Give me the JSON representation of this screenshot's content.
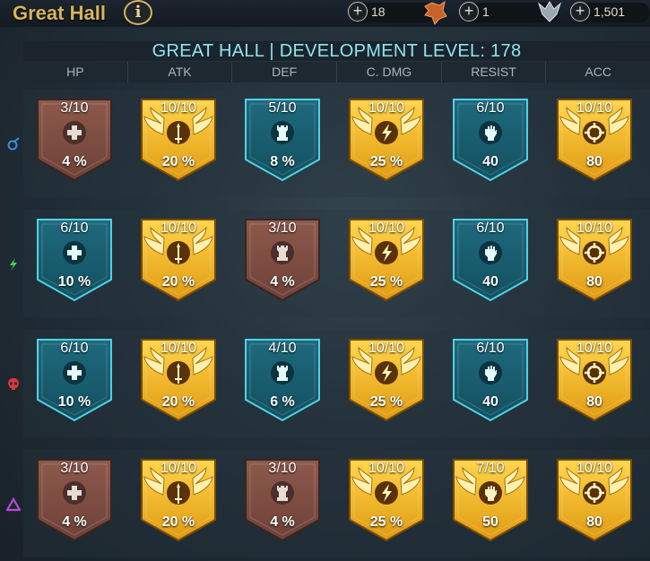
{
  "window": {
    "title": "Great Hall"
  },
  "resources": [
    {
      "name": "red-gem",
      "amount": "18"
    },
    {
      "name": "silver-medal",
      "amount": "1"
    },
    {
      "name": "gold-medal",
      "amount": "1,501"
    }
  ],
  "hall": {
    "title": "GREAT HALL | DEVELOPMENT LEVEL: 178",
    "columns": [
      "HP",
      "ATK",
      "DEF",
      "C. DMG",
      "RESIST",
      "ACC"
    ]
  },
  "affinities": [
    {
      "name": "magic",
      "color": "#3a8fd8"
    },
    {
      "name": "spirit",
      "color": "#3fd84a"
    },
    {
      "name": "force",
      "color": "#e0363a"
    },
    {
      "name": "void",
      "color": "#b94bd8"
    }
  ],
  "rows": [
    {
      "affinity": "magic",
      "cells": [
        {
          "stat": "hp",
          "level": "3/10",
          "value": "4 %",
          "tier": "bronze"
        },
        {
          "stat": "atk",
          "level": "10/10",
          "value": "20 %",
          "tier": "gold"
        },
        {
          "stat": "def",
          "level": "5/10",
          "value": "8 %",
          "tier": "blue"
        },
        {
          "stat": "cdmg",
          "level": "10/10",
          "value": "25 %",
          "tier": "gold"
        },
        {
          "stat": "resist",
          "level": "6/10",
          "value": "40",
          "tier": "blue"
        },
        {
          "stat": "acc",
          "level": "10/10",
          "value": "80",
          "tier": "gold"
        }
      ]
    },
    {
      "affinity": "spirit",
      "cells": [
        {
          "stat": "hp",
          "level": "6/10",
          "value": "10 %",
          "tier": "blue"
        },
        {
          "stat": "atk",
          "level": "10/10",
          "value": "20 %",
          "tier": "gold"
        },
        {
          "stat": "def",
          "level": "3/10",
          "value": "4 %",
          "tier": "bronze"
        },
        {
          "stat": "cdmg",
          "level": "10/10",
          "value": "25 %",
          "tier": "gold"
        },
        {
          "stat": "resist",
          "level": "6/10",
          "value": "40",
          "tier": "blue"
        },
        {
          "stat": "acc",
          "level": "10/10",
          "value": "80",
          "tier": "gold"
        }
      ]
    },
    {
      "affinity": "force",
      "cells": [
        {
          "stat": "hp",
          "level": "6/10",
          "value": "10 %",
          "tier": "blue"
        },
        {
          "stat": "atk",
          "level": "10/10",
          "value": "20 %",
          "tier": "gold"
        },
        {
          "stat": "def",
          "level": "4/10",
          "value": "6 %",
          "tier": "blue"
        },
        {
          "stat": "cdmg",
          "level": "10/10",
          "value": "25 %",
          "tier": "gold"
        },
        {
          "stat": "resist",
          "level": "6/10",
          "value": "40",
          "tier": "blue"
        },
        {
          "stat": "acc",
          "level": "10/10",
          "value": "80",
          "tier": "gold"
        }
      ]
    },
    {
      "affinity": "void",
      "cells": [
        {
          "stat": "hp",
          "level": "3/10",
          "value": "4 %",
          "tier": "bronze"
        },
        {
          "stat": "atk",
          "level": "10/10",
          "value": "20 %",
          "tier": "gold"
        },
        {
          "stat": "def",
          "level": "3/10",
          "value": "4 %",
          "tier": "bronze"
        },
        {
          "stat": "cdmg",
          "level": "10/10",
          "value": "25 %",
          "tier": "gold"
        },
        {
          "stat": "resist",
          "level": "7/10",
          "value": "50",
          "tier": "gold"
        },
        {
          "stat": "acc",
          "level": "10/10",
          "value": "80",
          "tier": "gold"
        }
      ]
    }
  ]
}
